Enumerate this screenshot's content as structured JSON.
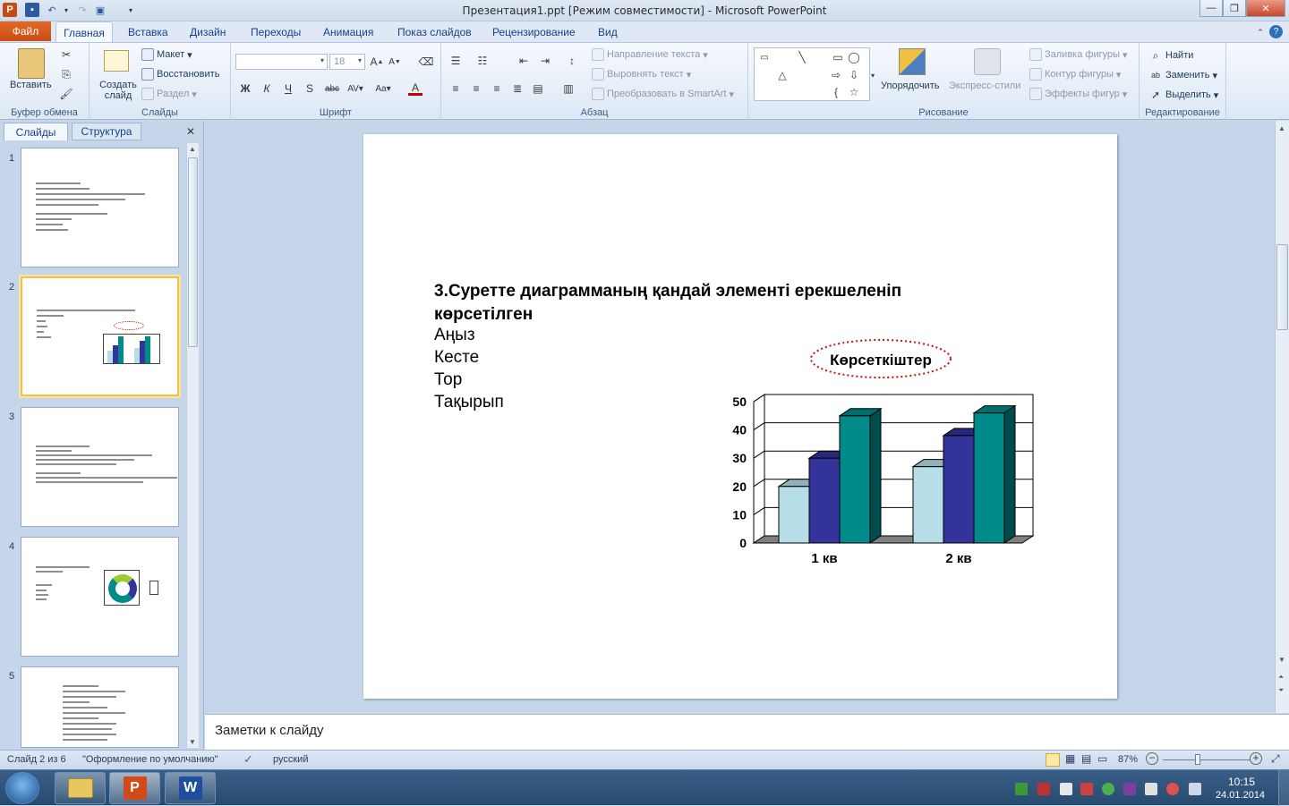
{
  "window": {
    "title": "Презентация1.ppt [Режим совместимости]  -  Microsoft PowerPoint",
    "minimize": "—",
    "maximize": "❐",
    "close": "✕"
  },
  "ribbon_tabs": {
    "file": "Файл",
    "items": [
      "Главная",
      "Вставка",
      "Дизайн",
      "Переходы",
      "Анимация",
      "Показ слайдов",
      "Рецензирование",
      "Вид"
    ]
  },
  "ribbon": {
    "clipboard": {
      "label": "Буфер обмена",
      "paste": "Вставить"
    },
    "slides": {
      "label": "Слайды",
      "new_slide": "Создать слайд",
      "layout": "Макет",
      "reset": "Восстановить",
      "section": "Раздел"
    },
    "font": {
      "label": "Шрифт",
      "size": "18",
      "bold": "Ж",
      "italic": "К",
      "underline": "Ч",
      "strike": "abc",
      "shadow": "S"
    },
    "paragraph": {
      "label": "Абзац",
      "text_direction": "Направление текста",
      "align_text": "Выровнять текст",
      "smartart": "Преобразовать в SmartArt"
    },
    "drawing": {
      "label": "Рисование",
      "arrange": "Упорядочить",
      "quick_styles": "Экспресс-стили",
      "shape_fill": "Заливка фигуры",
      "shape_outline": "Контур фигуры",
      "shape_effects": "Эффекты фигур"
    },
    "editing": {
      "label": "Редактирование",
      "find": "Найти",
      "replace": "Заменить",
      "select": "Выделить"
    }
  },
  "panel_tabs": {
    "slides": "Слайды",
    "outline": "Структура"
  },
  "thumbnails": [
    "1",
    "2",
    "3",
    "4",
    "5"
  ],
  "slide": {
    "question_line1": "3.Суретте диаграмманың қандай элементі ерекшеленіп",
    "question_line2": "көрсетілген",
    "options": [
      "Аңыз",
      "Кесте",
      "Тор",
      "Тақырып"
    ],
    "chart_title": "Көрсеткіштер"
  },
  "chart_data": {
    "type": "bar",
    "title": "Көрсеткіштер",
    "categories": [
      "1 кв",
      "2 кв"
    ],
    "series": [
      {
        "values": [
          20,
          27
        ],
        "color": "#b7dde8"
      },
      {
        "values": [
          30,
          38
        ],
        "color": "#333399"
      },
      {
        "values": [
          45,
          46
        ],
        "color": "#008a8a"
      }
    ],
    "yticks": [
      "0",
      "10",
      "20",
      "30",
      "40",
      "50"
    ],
    "ylim": [
      0,
      50
    ],
    "grid": true
  },
  "notes": {
    "placeholder": "Заметки к слайду"
  },
  "status": {
    "slide_info": "Слайд 2 из 6",
    "theme": "\"Оформление по умолчанию\"",
    "language": "русский",
    "zoom": "87%"
  },
  "clock": {
    "time": "10:15",
    "date": "24.01.2014"
  }
}
